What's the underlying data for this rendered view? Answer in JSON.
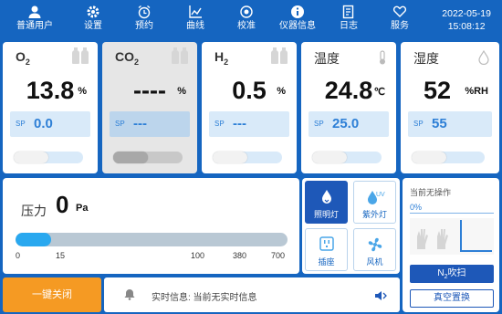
{
  "nav": {
    "items": [
      {
        "label": "普通用户",
        "icon": "user-icon"
      },
      {
        "label": "设置",
        "icon": "gear-icon"
      },
      {
        "label": "预约",
        "icon": "alarm-clock-icon"
      },
      {
        "label": "曲线",
        "icon": "line-chart-icon"
      },
      {
        "label": "校准",
        "icon": "target-icon"
      },
      {
        "label": "仪器信息",
        "icon": "info-icon"
      },
      {
        "label": "日志",
        "icon": "log-icon"
      },
      {
        "label": "服务",
        "icon": "heart-hand-icon"
      }
    ],
    "date": "2022-05-19",
    "time": "15:08:12"
  },
  "cards": [
    {
      "name": "O",
      "sub": "2",
      "value": "13.8",
      "unit": "%",
      "sp_label": "SP",
      "sp_value": "0.0",
      "enabled": true,
      "bottles": [
        "O2",
        "N2"
      ]
    },
    {
      "name": "CO",
      "sub": "2",
      "value": "----",
      "unit": "%",
      "sp_label": "SP",
      "sp_value": "---",
      "enabled": false,
      "bottles": [
        "CO2",
        "N2"
      ]
    },
    {
      "name": "H",
      "sub": "2",
      "value": "0.5",
      "unit": "%",
      "sp_label": "SP",
      "sp_value": "---",
      "enabled": true,
      "bottles": [
        "H2",
        "N2"
      ]
    },
    {
      "name": "温度",
      "sub": "",
      "value": "24.8",
      "unit": "℃",
      "sp_label": "SP",
      "sp_value": "25.0",
      "enabled": true,
      "icon": "thermometer-icon"
    },
    {
      "name": "湿度",
      "sub": "",
      "value": "52",
      "unit": "%RH",
      "sp_label": "SP",
      "sp_value": "55",
      "enabled": true,
      "icon": "droplet-icon"
    }
  ],
  "pressure": {
    "label": "压力",
    "value": "0",
    "unit": "Pa",
    "fill_fraction": 0.13,
    "ticks": [
      "0",
      "15",
      "100",
      "380",
      "700"
    ]
  },
  "functions": [
    {
      "label": "照明灯",
      "icon": "lamp-icon",
      "active": true
    },
    {
      "label": "紫外灯",
      "icon": "uv-lamp-icon",
      "active": false
    },
    {
      "label": "插座",
      "icon": "socket-icon",
      "active": false
    },
    {
      "label": "风机",
      "icon": "fan-icon",
      "active": false
    }
  ],
  "side": {
    "status": "当前无操作",
    "progress": "0%",
    "purge_prefix": "N",
    "purge_sub": "2",
    "purge_suffix": "吹扫",
    "vacuum": "真空置换"
  },
  "bottom": {
    "onekey": "一键关闭",
    "info": "实时信息: 当前无实时信息"
  },
  "colors": {
    "primary": "#1565c0",
    "accent": "#2d7fd6",
    "warning": "#f59a23",
    "active": "#1e58b8"
  }
}
